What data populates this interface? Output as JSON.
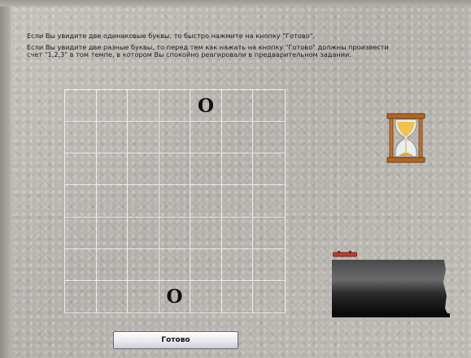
{
  "instructions": {
    "line1": "Если Вы увидите две одинаковые буквы, то быстро нажмите на кнопку \"Готово\".",
    "line2": "Если Вы увидите две разные буквы, то перед тем как нажать на кнопку \"Готово\" должны произвести",
    "line3": "счет \"1,2,3\" в том темпе, в котором Вы спокойно реагировали в предварительном задании."
  },
  "grid": {
    "rows": 7,
    "cols": 7,
    "letters": [
      {
        "row": 0,
        "col": 4,
        "char": "O"
      },
      {
        "row": 6,
        "col": 3,
        "char": "O"
      }
    ]
  },
  "timer": {
    "icon": "hourglass-icon"
  },
  "progress": {
    "icon": "progress-indicator"
  },
  "button": {
    "ready_label": "Готово"
  },
  "colors": {
    "background": "#b9b6b1",
    "grid_line": "#ffffff",
    "hourglass_frame": "#b3651f",
    "hourglass_sand": "#f1c24e",
    "indicator_red": "#c0392b"
  }
}
